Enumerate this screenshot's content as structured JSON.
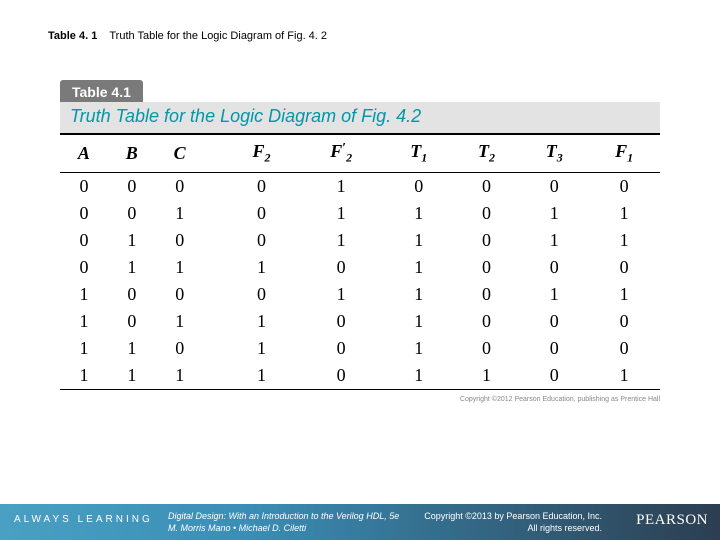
{
  "caption": {
    "label": "Table 4. 1",
    "text": "Truth Table for the Logic Diagram of Fig. 4. 2"
  },
  "figure": {
    "tab": "Table 4.1",
    "title": "Truth Table for the Logic Diagram of Fig. 4.2",
    "fine_print": "Copyright ©2012 Pearson Education, publishing as Prentice Hall"
  },
  "chart_data": {
    "type": "table",
    "columns": [
      "A",
      "B",
      "C",
      "F2",
      "F'2",
      "T1",
      "T2",
      "T3",
      "F1"
    ],
    "rows": [
      [
        0,
        0,
        0,
        0,
        1,
        0,
        0,
        0,
        0
      ],
      [
        0,
        0,
        1,
        0,
        1,
        1,
        0,
        1,
        1
      ],
      [
        0,
        1,
        0,
        0,
        1,
        1,
        0,
        1,
        1
      ],
      [
        0,
        1,
        1,
        1,
        0,
        1,
        0,
        0,
        0
      ],
      [
        1,
        0,
        0,
        0,
        1,
        1,
        0,
        1,
        1
      ],
      [
        1,
        0,
        1,
        1,
        0,
        1,
        0,
        0,
        0
      ],
      [
        1,
        1,
        0,
        1,
        0,
        1,
        0,
        0,
        0
      ],
      [
        1,
        1,
        1,
        1,
        0,
        1,
        1,
        0,
        1
      ]
    ]
  },
  "footer": {
    "always": "ALWAYS LEARNING",
    "book_line1": "Digital Design: With an Introduction to the Verilog HDL, 5e",
    "book_line2": "M. Morris Mano • Michael D. Ciletti",
    "copy_line1": "Copyright ©2013 by Pearson Education, Inc.",
    "copy_line2": "All rights reserved.",
    "brand": "PEARSON"
  }
}
